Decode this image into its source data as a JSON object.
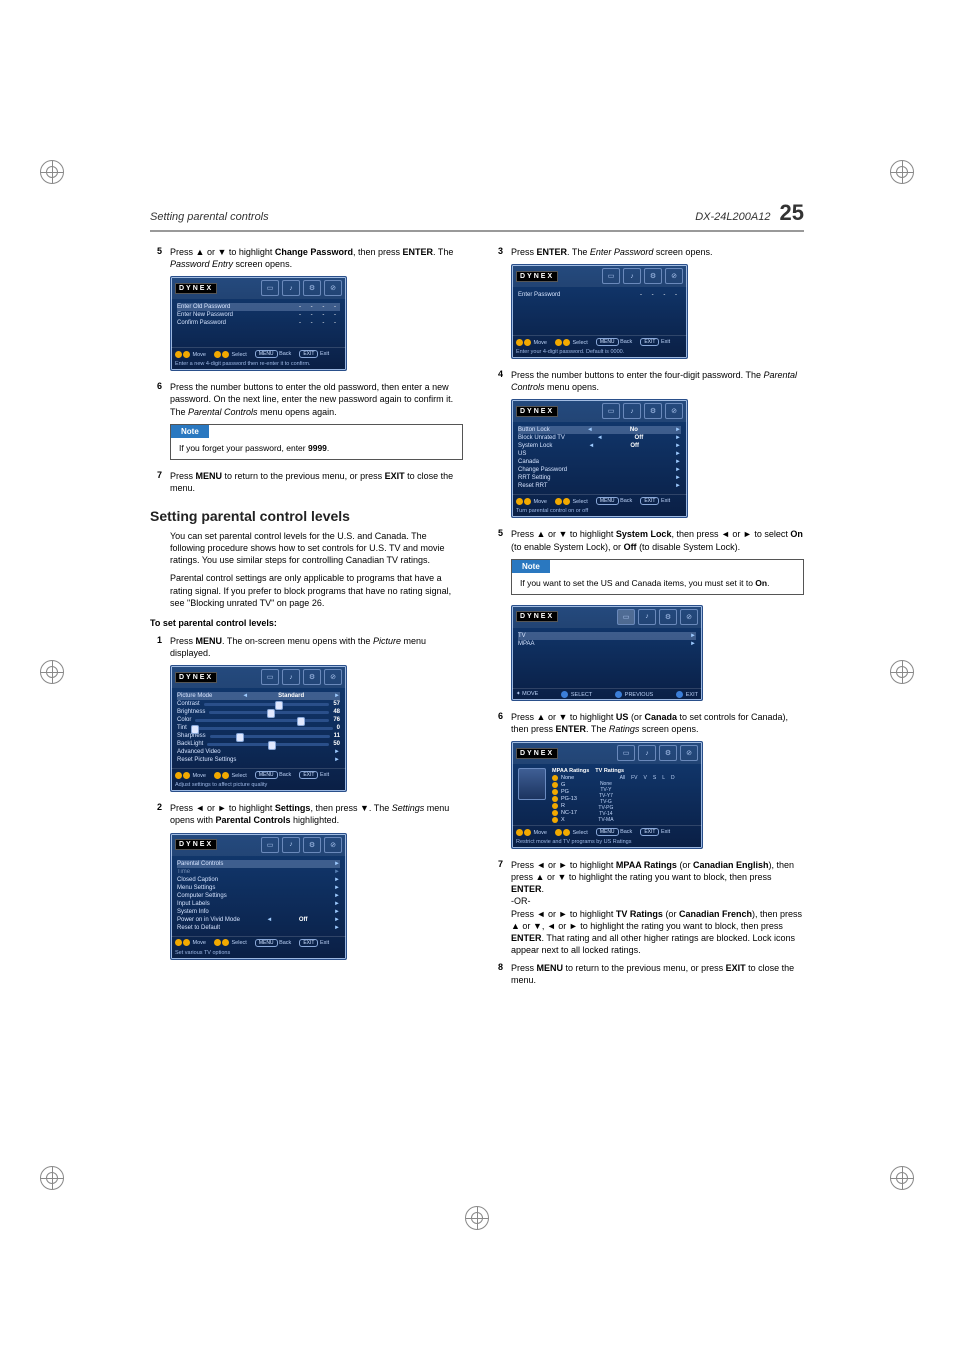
{
  "header": {
    "section": "Setting parental controls",
    "model": "DX-24L200A12",
    "page": "25"
  },
  "brand": "DYNEX",
  "left": {
    "step5": {
      "num": "5",
      "pre": "Press ",
      "mid1": " or ",
      "mid2": " to highlight ",
      "bold1": "Change Password",
      "post1": ", then press ",
      "bold2": "ENTER",
      "post2": ". The ",
      "ital": "Password Entry",
      "post3": " screen opens."
    },
    "osd_pw": {
      "title": "Enter Old Password",
      "row2": "Enter New Password",
      "row3": "Confirm Password",
      "dash": "- - - -",
      "foot_move": "Move",
      "foot_select": "Select",
      "foot_back": "Back",
      "foot_exit": "Exit",
      "menu": "MENU",
      "exit": "EXIT",
      "hint": "Enter a new 4-digit password then re-enter it to confirm."
    },
    "step6": {
      "num": "6",
      "text1": "Press the number buttons to enter the old password, then enter a new password. On the next line, enter the new password again to confirm it. The ",
      "ital": "Parental Controls",
      "text2": " menu opens again."
    },
    "note1": {
      "tab": "Note",
      "body1": "If you forget your password, enter ",
      "bold": "9999",
      "body2": "."
    },
    "step7": {
      "num": "7",
      "a": "Press ",
      "b": "MENU",
      "c": " to return to the previous menu, or press ",
      "d": "EXIT",
      "e": " to close the menu."
    },
    "heading": "Setting parental control levels",
    "para1": "You can set parental control levels for the U.S. and Canada. The following procedure shows how to set controls for U.S. TV and movie ratings. You use similar steps for controlling Canadian TV ratings.",
    "para2a": "Parental control settings are only applicable to programs that have a rating signal. If you prefer to block programs that have no rating signal, see \"Blocking unrated TV\" on page ",
    "para2b": "26.",
    "subhead": "To set parental control levels:",
    "l_step1": {
      "num": "1",
      "a": "Press ",
      "b": "MENU",
      "c": ". The on-screen menu opens with the ",
      "d": "Picture",
      "e": " menu displayed."
    },
    "osd_picture": {
      "rows": [
        {
          "label": "Picture Mode",
          "value": "Standard"
        },
        {
          "label": "Contrast",
          "value": "57"
        },
        {
          "label": "Brightness",
          "value": "48"
        },
        {
          "label": "Color",
          "value": "76"
        },
        {
          "label": "Tint",
          "value": "0"
        },
        {
          "label": "Sharpness",
          "value": "11"
        },
        {
          "label": "BackLight",
          "value": "50"
        },
        {
          "label": "Advanced Video",
          "value": ""
        },
        {
          "label": "Reset Picture Settings",
          "value": ""
        }
      ],
      "hint": "Adjust settings to affect picture quality"
    },
    "l_step2": {
      "num": "2",
      "a": "Press ",
      "b": " or ",
      "c": " to highlight ",
      "d": "Settings",
      "e": ", then press ",
      "f": ". The ",
      "g": "Settings",
      "h": " menu opens with ",
      "i": "Parental Controls",
      "j": " highlighted."
    },
    "osd_settings": {
      "rows": [
        {
          "label": "Parental Controls"
        },
        {
          "label": "Time"
        },
        {
          "label": "Closed Caption"
        },
        {
          "label": "Menu Settings"
        },
        {
          "label": "Computer Settings"
        },
        {
          "label": "Input Labels"
        },
        {
          "label": "System Info"
        },
        {
          "label": "Power on in Vivid Mode",
          "value": "Off"
        },
        {
          "label": "Reset to Default"
        }
      ],
      "hint": "Set various TV options"
    }
  },
  "right": {
    "r_step3": {
      "num": "3",
      "a": "Press ",
      "b": "ENTER",
      "c": ". The ",
      "d": "Enter Password",
      "e": " screen opens."
    },
    "osd_pw2": {
      "title": "Enter Password",
      "dash": "- - - -",
      "hint": "Enter your 4-digit password. Default is 0000."
    },
    "r_step4": {
      "num": "4",
      "a": "Press the number buttons to enter the four-digit password. The ",
      "b": "Parental Controls",
      "c": " menu opens."
    },
    "osd_parental": {
      "rows": [
        {
          "label": "Button Lock",
          "value": "No"
        },
        {
          "label": "Block Unrated TV",
          "value": "Off"
        },
        {
          "label": "System Lock",
          "value": "Off"
        },
        {
          "label": "US"
        },
        {
          "label": "Canada"
        },
        {
          "label": "Change Password"
        },
        {
          "label": "RRT Setting"
        },
        {
          "label": "Reset RRT"
        }
      ],
      "hint": "Turn parental control on or off"
    },
    "r_step5": {
      "num": "5",
      "a": "Press ",
      "b": " or ",
      "c": " to highlight ",
      "d": "System Lock",
      "e": ", then press ",
      "f": " or ",
      "g": " to select ",
      "h": "On",
      "i": " (to enable System Lock), or ",
      "j": "Off",
      "k": " (to disable System Lock)."
    },
    "note2": {
      "tab": "Note",
      "body1": "If you want to set the US and Canada items, you must set it to ",
      "bold": "On",
      "body2": "."
    },
    "osd_us": {
      "rows": [
        {
          "label": "TV"
        },
        {
          "label": "MPAA"
        }
      ],
      "foot_move": "MOVE",
      "foot_select": "SELECT",
      "foot_prev": "PREVIOUS",
      "foot_exit": "EXIT"
    },
    "r_step6": {
      "num": "6",
      "a": "Press ",
      "b": " or ",
      "c": " to highlight ",
      "d": "US",
      "e": " (or ",
      "f": "Canada",
      "g": " to set controls for Canada), then press ",
      "h": "ENTER",
      "i": ". The ",
      "j": "Ratings",
      "k": " screen opens."
    },
    "osd_ratings": {
      "mpaa_title": "MPAA Ratings",
      "tv_title": "TV Ratings",
      "mpaa": [
        "None",
        "G",
        "PG",
        "PG-13",
        "R",
        "NC-17",
        "X"
      ],
      "tv_rows": [
        "None",
        "TV-Y",
        "TV-Y7",
        "TV-G",
        "TV-PG",
        "TV-14",
        "TV-MA"
      ],
      "tv_cols": [
        "All",
        "FV",
        "V",
        "S",
        "L",
        "D"
      ],
      "hint": "Restrict movie and TV programs by US Ratings"
    },
    "r_step7": {
      "num": "7",
      "a": "Press ",
      "b": " or ",
      "c": " to highlight ",
      "d": "MPAA Ratings",
      "e": " (or ",
      "f": "Canadian English",
      "g": "), then press ",
      "h": " or ",
      "i": " to highlight the rating you want to block, then press ",
      "j": "ENTER",
      "k": ".",
      "or": "-OR-",
      "l": "Press ",
      "m": " or ",
      "n": " to highlight ",
      "o": "TV Ratings",
      "p": " (or ",
      "q": "Canadian French",
      "r": "), then press ",
      "s": " or ",
      "t": ", ",
      "u": " or ",
      "v": " to highlight the rating you want to block, then press ",
      "w": "ENTER",
      "x": ". That rating and all other higher ratings are blocked. Lock icons appear next to all locked ratings."
    },
    "r_step8": {
      "num": "8",
      "a": "Press ",
      "b": "MENU",
      "c": " to return to the previous menu, or press ",
      "d": "EXIT",
      "e": " to close the menu."
    }
  },
  "footer": {
    "move": "Move",
    "select": "Select",
    "menu": "MENU",
    "back": "Back",
    "exit_btn": "EXIT",
    "exit": "Exit"
  }
}
